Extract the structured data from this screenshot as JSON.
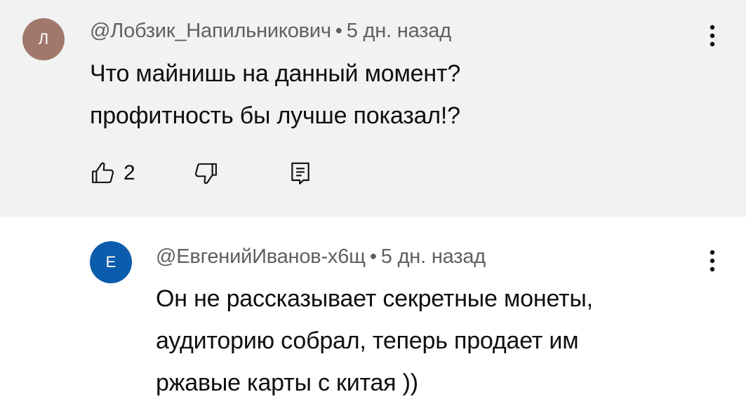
{
  "comments": {
    "top": {
      "avatar_letter": "Л",
      "avatar_color": "#a1786b",
      "author": "@Лобзик_Напильникович",
      "separator": "•",
      "time": "5 дн. назад",
      "text_lines": [
        "Что майнишь на данный момент?",
        "профитность бы лучше показал!?"
      ],
      "likes": "2"
    },
    "reply": {
      "avatar_letter": "Е",
      "avatar_color": "#0b5cad",
      "author": "@ЕвгенийИванов-х6щ",
      "separator": "•",
      "time": "5 дн. назад",
      "text_lines": [
        "Он не рассказывает секретные монеты,",
        "аудиторию собрал, теперь продает им",
        "ржавые карты с китая ))"
      ]
    }
  },
  "icons": {
    "more": "more-vert-icon",
    "like": "thumb-up-icon",
    "dislike": "thumb-down-icon",
    "reply": "comment-icon"
  },
  "colors": {
    "top_background": "#f2f2f2",
    "reply_background": "#ffffff",
    "text_primary": "#0f0f0f",
    "text_secondary": "#606060"
  }
}
